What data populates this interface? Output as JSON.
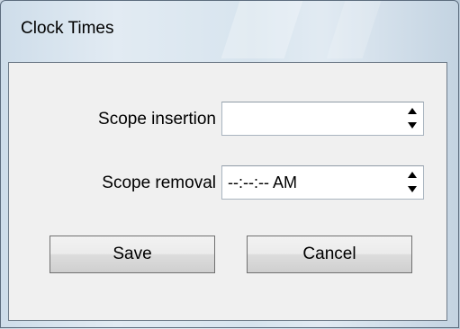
{
  "window": {
    "title": "Clock Times"
  },
  "form": {
    "fields": [
      {
        "label": "Scope insertion",
        "value": ""
      },
      {
        "label": "Scope removal",
        "value": "--:--:-- AM"
      }
    ]
  },
  "buttons": {
    "save_label": "Save",
    "cancel_label": "Cancel"
  },
  "icons": {
    "spin_up": "triangle-up-icon",
    "spin_down": "triangle-down-icon"
  }
}
